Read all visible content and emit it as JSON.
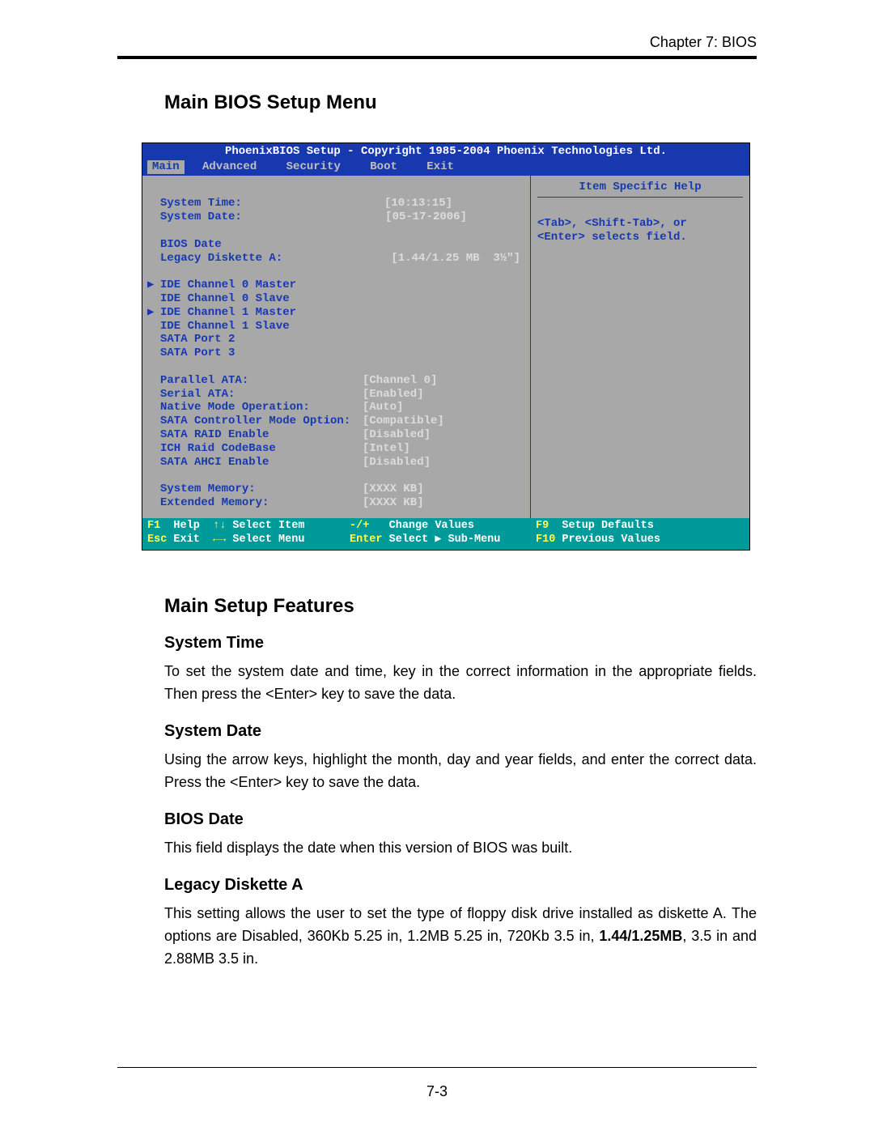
{
  "header": {
    "chapter": "Chapter 7: BIOS"
  },
  "section1": {
    "title": "Main BIOS Setup Menu"
  },
  "bios": {
    "title": "PhoenixBIOS Setup - Copyright 1985-2004 Phoenix Technologies Ltd.",
    "tabs": {
      "t0": "Main",
      "t1": "Advanced",
      "t2": "Security",
      "t3": "Boot",
      "t4": "Exit"
    },
    "help": {
      "title": "Item Specific Help",
      "line1": "<Tab>, <Shift-Tab>, or",
      "line2": "<Enter> selects field."
    },
    "rows": {
      "system_time_l": "System Time:",
      "system_time_v": "[10:13:15]",
      "system_date_l": "System Date:",
      "system_date_v": "[05-17-2006]",
      "bios_date_l": "BIOS Date",
      "legacy_l": "Legacy Diskette A:",
      "legacy_v": "[1.44/1.25 MB  3½\"]",
      "ide0m": "IDE Channel 0 Master",
      "ide0s": "IDE Channel 0 Slave",
      "ide1m": "IDE Channel 1 Master",
      "ide1s": "IDE Channel 1 Slave",
      "sata2": "SATA Port 2",
      "sata3": "SATA Port 3",
      "pata_l": "Parallel ATA:",
      "pata_v": "[Channel 0]",
      "sata_l": "Serial ATA:",
      "sata_v": "[Enabled]",
      "native_l": "Native Mode Operation:",
      "native_v": "[Auto]",
      "ctrl_l": "SATA Controller Mode Option:",
      "ctrl_v": "[Compatible]",
      "raid_l": "SATA RAID Enable",
      "raid_v": "[Disabled]",
      "ich_l": "ICH Raid CodeBase",
      "ich_v": "[Intel]",
      "ahci_l": "SATA AHCI Enable",
      "ahci_v": "[Disabled]",
      "sysmem_l": "System Memory:",
      "sysmem_v": "[XXXX KB]",
      "extmem_l": "Extended Memory:",
      "extmem_v": "[XXXX KB]"
    },
    "footer": {
      "f1": "F1",
      "help": "Help",
      "ud": "↑↓",
      "selitem": "Select Item",
      "pm": "-/+",
      "chval": "Change Values",
      "f9": "F9",
      "setupdef": "Setup Defaults",
      "esc": "Esc",
      "exit": "Exit",
      "lr": "←→",
      "selmenu": "Select Menu",
      "enter": "Enter",
      "selsub": "Select ▶ Sub-Menu",
      "f10": "F10",
      "prev": "Previous Values"
    }
  },
  "section2": {
    "title": "Main Setup Features"
  },
  "features": {
    "systime_h": "System Time",
    "systime_p": "To set the system date and time, key in the correct information in the appropriate fields.  Then press the <Enter> key to save the data.",
    "sysdate_h": "System Date",
    "sysdate_p": "Using the arrow keys, highlight the month, day and year fields, and enter the correct data.  Press the <Enter> key to save the data.",
    "biosdate_h": "BIOS Date",
    "biosdate_p": "This field displays the date when this version of BIOS was built.",
    "legacy_h": "Legacy Diskette A",
    "legacy_p1": "This setting allows the user to set the type of floppy disk drive installed as diskette A. The options are Disabled, 360Kb 5.25 in, 1.2MB 5.25 in, 720Kb 3.5 in, ",
    "legacy_bold": "1.44/1.25MB",
    "legacy_p2": ", 3.5 in and 2.88MB 3.5 in."
  },
  "pagenum": "7-3"
}
